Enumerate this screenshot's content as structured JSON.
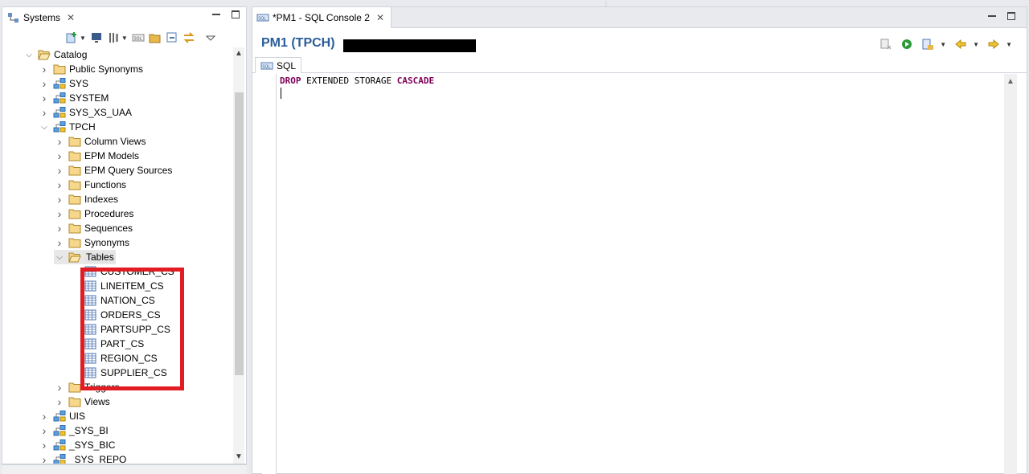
{
  "left": {
    "tab_label": "Systems",
    "tree": [
      {
        "label": "Catalog",
        "kind": "folder-open",
        "depth": 0,
        "expanded": true
      },
      {
        "label": "Public Synonyms",
        "kind": "folder",
        "depth": 1
      },
      {
        "label": "SYS",
        "kind": "schema",
        "depth": 1
      },
      {
        "label": "SYSTEM",
        "kind": "schema",
        "depth": 1
      },
      {
        "label": "SYS_XS_UAA",
        "kind": "schema",
        "depth": 1
      },
      {
        "label": "TPCH",
        "kind": "schema",
        "depth": 1,
        "expanded": true
      },
      {
        "label": "Column Views",
        "kind": "folder",
        "depth": 2
      },
      {
        "label": "EPM Models",
        "kind": "folder",
        "depth": 2
      },
      {
        "label": "EPM Query Sources",
        "kind": "folder",
        "depth": 2
      },
      {
        "label": "Functions",
        "kind": "folder",
        "depth": 2
      },
      {
        "label": "Indexes",
        "kind": "folder",
        "depth": 2
      },
      {
        "label": "Procedures",
        "kind": "folder",
        "depth": 2
      },
      {
        "label": "Sequences",
        "kind": "folder",
        "depth": 2
      },
      {
        "label": "Synonyms",
        "kind": "folder",
        "depth": 2
      },
      {
        "label": "Tables",
        "kind": "folder-open",
        "depth": 2,
        "expanded": true,
        "selected": true
      },
      {
        "label": "CUSTOMER_CS",
        "kind": "table",
        "depth": 3
      },
      {
        "label": "LINEITEM_CS",
        "kind": "table",
        "depth": 3
      },
      {
        "label": "NATION_CS",
        "kind": "table",
        "depth": 3
      },
      {
        "label": "ORDERS_CS",
        "kind": "table",
        "depth": 3
      },
      {
        "label": "PARTSUPP_CS",
        "kind": "table",
        "depth": 3
      },
      {
        "label": "PART_CS",
        "kind": "table",
        "depth": 3
      },
      {
        "label": "REGION_CS",
        "kind": "table",
        "depth": 3
      },
      {
        "label": "SUPPLIER_CS",
        "kind": "table",
        "depth": 3
      },
      {
        "label": "Triggers",
        "kind": "folder",
        "depth": 2
      },
      {
        "label": "Views",
        "kind": "folder",
        "depth": 2
      },
      {
        "label": "UIS",
        "kind": "schema",
        "depth": 1
      },
      {
        "label": "_SYS_BI",
        "kind": "schema",
        "depth": 1
      },
      {
        "label": "_SYS_BIC",
        "kind": "schema",
        "depth": 1
      },
      {
        "label": "_SYS_REPO",
        "kind": "schema",
        "depth": 1
      }
    ]
  },
  "right": {
    "tab_label": "*PM1 - SQL Console 2",
    "connection_title": "PM1 (TPCH)",
    "sql_tab_label": "SQL",
    "sql_tokens": [
      {
        "text": "DROP",
        "kw": true
      },
      {
        "text": " EXTENDED STORAGE ",
        "kw": false
      },
      {
        "text": "CASCADE",
        "kw": true
      }
    ]
  },
  "colors": {
    "highlight_box": "#e11d23",
    "title_blue": "#2a5d9a",
    "keyword": "#7f0055"
  }
}
